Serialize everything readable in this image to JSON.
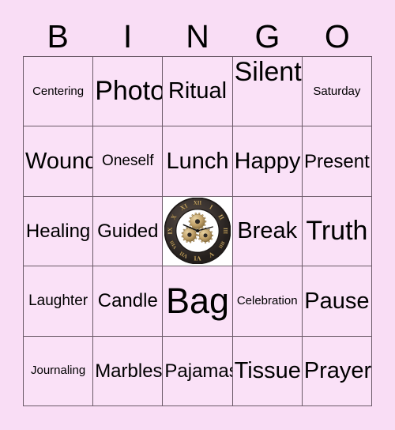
{
  "card": {
    "background_color": "#f9ddf5",
    "cell_color": "#fae1f7",
    "border_color": "#6b5a68",
    "text_color": "#000000"
  },
  "header": {
    "letters": [
      "B",
      "I",
      "N",
      "G",
      "O"
    ]
  },
  "grid": {
    "rows": [
      [
        {
          "text": "Centering",
          "size": "xs",
          "align": "middle"
        },
        {
          "text": "Photo",
          "size": "xl",
          "align": "middle"
        },
        {
          "text": "Ritual",
          "size": "l",
          "align": "middle"
        },
        {
          "text": "Silent",
          "size": "xl",
          "align": "top"
        },
        {
          "text": "Saturday",
          "size": "xs",
          "align": "middle"
        }
      ],
      [
        {
          "text": "Wound",
          "size": "l",
          "align": "middle"
        },
        {
          "text": "Oneself",
          "size": "s",
          "align": "middle"
        },
        {
          "text": "Lunch",
          "size": "l",
          "align": "middle"
        },
        {
          "text": "Happy",
          "size": "l",
          "align": "middle"
        },
        {
          "text": "Present",
          "size": "m",
          "align": "middle"
        }
      ],
      [
        {
          "text": "Healing",
          "size": "m",
          "align": "middle"
        },
        {
          "text": "Guided",
          "size": "m",
          "align": "middle"
        },
        {
          "type": "free",
          "icon": "roman-numeral-gear-clock-image",
          "text": ""
        },
        {
          "text": "Break",
          "size": "l",
          "align": "middle"
        },
        {
          "text": "Truth",
          "size": "xl",
          "align": "middle"
        }
      ],
      [
        {
          "text": "Laughter",
          "size": "s",
          "align": "middle"
        },
        {
          "text": "Candle",
          "size": "m",
          "align": "middle"
        },
        {
          "text": "Bag",
          "size": "xxl",
          "align": "middle"
        },
        {
          "text": "Celebration",
          "size": "xs",
          "align": "middle"
        },
        {
          "text": "Pause",
          "size": "l",
          "align": "middle"
        }
      ],
      [
        {
          "text": "Journaling",
          "size": "xs",
          "align": "middle"
        },
        {
          "text": "Marbles",
          "size": "m",
          "align": "middle"
        },
        {
          "text": "Pajamas",
          "size": "m",
          "align": "middle"
        },
        {
          "text": "Tissue",
          "size": "l",
          "align": "middle"
        },
        {
          "text": "Prayer",
          "size": "l",
          "align": "middle"
        }
      ]
    ]
  },
  "free_space": {
    "image_name": "roman-numeral-gear-clock",
    "numerals": [
      "XII",
      "I",
      "II",
      "III",
      "IIII",
      "V",
      "VI",
      "VII",
      "VIII",
      "IX",
      "X",
      "XI"
    ],
    "frame_color": "#3a3330",
    "numeral_color": "#d8bc7c"
  }
}
